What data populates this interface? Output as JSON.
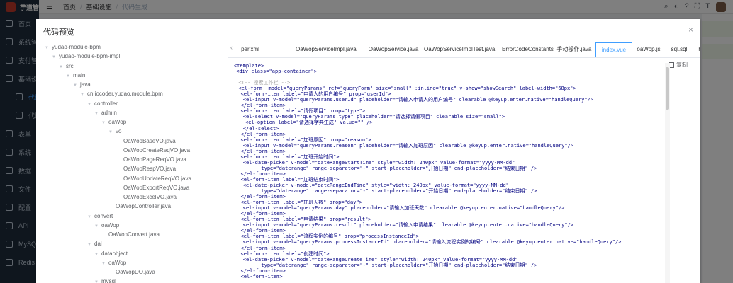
{
  "app": {
    "title": "芋道管理系统"
  },
  "sidebar": {
    "items": [
      {
        "label": "首页"
      },
      {
        "label": "系统管理"
      },
      {
        "label": "支付管理"
      },
      {
        "label": "基础设施"
      },
      {
        "label": "代码"
      },
      {
        "label": "代码"
      },
      {
        "label": "表单"
      },
      {
        "label": "系统"
      },
      {
        "label": "数据"
      },
      {
        "label": "文件"
      },
      {
        "label": "配置"
      },
      {
        "label": "API"
      },
      {
        "label": "MySQL"
      },
      {
        "label": "Redis"
      }
    ]
  },
  "breadcrumb": {
    "items": [
      "首页",
      "基础设施",
      "代码生成"
    ]
  },
  "dialog": {
    "title": "代码预览",
    "close": "×",
    "copy_label": "复制"
  },
  "tree": [
    {
      "label": "yudao-module-bpm",
      "level": 0,
      "expandable": true
    },
    {
      "label": "yudao-module-bpm-impl",
      "level": 1,
      "expandable": true
    },
    {
      "label": "src",
      "level": 2,
      "expandable": true
    },
    {
      "label": "main",
      "level": 3,
      "expandable": true
    },
    {
      "label": "java",
      "level": 4,
      "expandable": true
    },
    {
      "label": "cn.iocoder.yudao.module.bpm",
      "level": 5,
      "expandable": true
    },
    {
      "label": "controller",
      "level": 6,
      "expandable": true
    },
    {
      "label": "admin",
      "level": 7,
      "expandable": true
    },
    {
      "label": "oaWop",
      "level": 8,
      "expandable": true
    },
    {
      "label": "vo",
      "level": 9,
      "expandable": true
    },
    {
      "label": "OaWopBaseVO.java",
      "level": 10,
      "expandable": false
    },
    {
      "label": "OaWopCreateReqVO.java",
      "level": 10,
      "expandable": false
    },
    {
      "label": "OaWopPageReqVO.java",
      "level": 10,
      "expandable": false
    },
    {
      "label": "OaWopRespVO.java",
      "level": 10,
      "expandable": false
    },
    {
      "label": "OaWopUpdateReqVO.java",
      "level": 10,
      "expandable": false
    },
    {
      "label": "OaWopExportReqVO.java",
      "level": 10,
      "expandable": false
    },
    {
      "label": "OaWopExcelVO.java",
      "level": 10,
      "expandable": false
    },
    {
      "label": "OaWopController.java",
      "level": 9,
      "expandable": false
    },
    {
      "label": "convert",
      "level": 6,
      "expandable": true
    },
    {
      "label": "oaWop",
      "level": 7,
      "expandable": true
    },
    {
      "label": "OaWopConvert.java",
      "level": 8,
      "expandable": false
    },
    {
      "label": "dal",
      "level": 6,
      "expandable": true
    },
    {
      "label": "dataobject",
      "level": 7,
      "expandable": true
    },
    {
      "label": "oaWop",
      "level": 8,
      "expandable": true
    },
    {
      "label": "OaWopDO.java",
      "level": 9,
      "expandable": false
    },
    {
      "label": "mysql",
      "level": 7,
      "expandable": true
    }
  ],
  "tabs": {
    "prev_icon": "‹",
    "items": [
      {
        "label": "per.xml",
        "active": false
      },
      {
        "label": "OaWopServiceImpl.java",
        "active": false
      },
      {
        "label": "OaWopService.java",
        "active": false
      },
      {
        "label": "OaWopServiceImplTest.java",
        "active": false
      },
      {
        "label": "ErrorCodeConstants_手动操作.java",
        "active": false
      },
      {
        "label": "index.vue",
        "active": true
      },
      {
        "label": "oaWop.js",
        "active": false
      },
      {
        "label": "sql.sql",
        "active": false
      },
      {
        "label": "h2.sql",
        "active": false
      }
    ]
  },
  "code": [
    {
      "text": "<template>",
      "indent": 0
    },
    {
      "text": "<div class=\"app-container\">",
      "indent": 1
    },
    {
      "text": "",
      "indent": 0
    },
    {
      "text": "<!-- 搜索工作栏 -->",
      "indent": 2,
      "comment": true
    },
    {
      "text": "<el-form :model=\"queryParams\" ref=\"queryForm\" size=\"small\" :inline=\"true\" v-show=\"showSearch\" label-width=\"68px\">",
      "indent": 2
    },
    {
      "text": "<el-form-item label=\"申请人的用户编号\" prop=\"userId\">",
      "indent": 3
    },
    {
      "text": "<el-input v-model=\"queryParams.userId\" placeholder=\"请输入申请人的用户编号\" clearable @keyup.enter.native=\"handleQuery\"/>",
      "indent": 4
    },
    {
      "text": "</el-form-item>",
      "indent": 3
    },
    {
      "text": "<el-form-item label=\"请假项目\" prop=\"type\">",
      "indent": 3
    },
    {
      "text": "<el-select v-model=\"queryParams.type\" placeholder=\"请选择请假项目\" clearable size=\"small\">",
      "indent": 4
    },
    {
      "text": "<el-option label=\"请选择字典生成\" value=\"\" />",
      "indent": 5
    },
    {
      "text": "</el-select>",
      "indent": 4
    },
    {
      "text": "</el-form-item>",
      "indent": 3
    },
    {
      "text": "<el-form-item label=\"加班原因\" prop=\"reason\">",
      "indent": 3
    },
    {
      "text": "<el-input v-model=\"queryParams.reason\" placeholder=\"请输入加班原因\" clearable @keyup.enter.native=\"handleQuery\"/>",
      "indent": 4
    },
    {
      "text": "</el-form-item>",
      "indent": 3
    },
    {
      "text": "<el-form-item label=\"加班开始时间\">",
      "indent": 3
    },
    {
      "text": "<el-date-picker v-model=\"dateRangeStartTime\" style=\"width: 240px\" value-format=\"yyyy-MM-dd\"",
      "indent": 4
    },
    {
      "text": "type=\"daterange\" range-separator=\"-\" start-placeholder=\"开始日期\" end-placeholder=\"结束日期\" />",
      "indent": 12
    },
    {
      "text": "</el-form-item>",
      "indent": 3
    },
    {
      "text": "<el-form-item label=\"加班结束时间\">",
      "indent": 3
    },
    {
      "text": "<el-date-picker v-model=\"dateRangeEndTime\" style=\"width: 240px\" value-format=\"yyyy-MM-dd\"",
      "indent": 4
    },
    {
      "text": "type=\"daterange\" range-separator=\"-\" start-placeholder=\"开始日期\" end-placeholder=\"结束日期\" />",
      "indent": 12
    },
    {
      "text": "</el-form-item>",
      "indent": 3
    },
    {
      "text": "<el-form-item label=\"加班天数\" prop=\"day\">",
      "indent": 3
    },
    {
      "text": "<el-input v-model=\"queryParams.day\" placeholder=\"请输入加班天数\" clearable @keyup.enter.native=\"handleQuery\"/>",
      "indent": 4
    },
    {
      "text": "</el-form-item>",
      "indent": 3
    },
    {
      "text": "<el-form-item label=\"申请结果\" prop=\"result\">",
      "indent": 3
    },
    {
      "text": "<el-input v-model=\"queryParams.result\" placeholder=\"请输入申请结果\" clearable @keyup.enter.native=\"handleQuery\"/>",
      "indent": 4
    },
    {
      "text": "</el-form-item>",
      "indent": 3
    },
    {
      "text": "<el-form-item label=\"流程实例的编号\" prop=\"processInstanceId\">",
      "indent": 3
    },
    {
      "text": "<el-input v-model=\"queryParams.processInstanceId\" placeholder=\"请输入流程实例的编号\" clearable @keyup.enter.native=\"handleQuery\"/>",
      "indent": 4
    },
    {
      "text": "</el-form-item>",
      "indent": 3
    },
    {
      "text": "<el-form-item label=\"创建时间\">",
      "indent": 3
    },
    {
      "text": "<el-date-picker v-model=\"dateRangeCreateTime\" style=\"width: 240px\" value-format=\"yyyy-MM-dd\"",
      "indent": 4
    },
    {
      "text": "type=\"daterange\" range-separator=\"-\" start-placeholder=\"开始日期\" end-placeholder=\"结束日期\" />",
      "indent": 12
    },
    {
      "text": "</el-form-item>",
      "indent": 3
    },
    {
      "text": "<el-form-item>",
      "indent": 3
    }
  ]
}
